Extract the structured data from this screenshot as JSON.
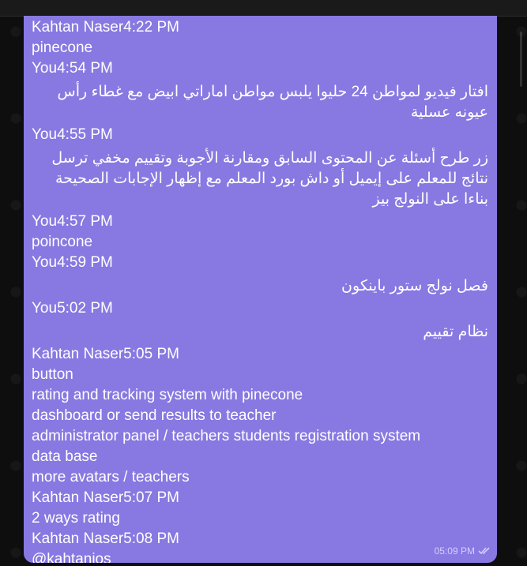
{
  "messages": [
    {
      "type": "header",
      "text": "Kahtan Naser4:22 PM"
    },
    {
      "type": "ltr",
      "text": "pinecone"
    },
    {
      "type": "header",
      "text": "You4:54 PM"
    },
    {
      "type": "rtl",
      "text": "افتار فيديو لمواطن 24  حليوا  يلبس مواطن اماراتي ابيض  مع غطاء رأس   عيونه عسلية"
    },
    {
      "type": "header",
      "text": "You4:55 PM"
    },
    {
      "type": "rtl",
      "text": "زر  طرح أسئلة  عن المحتوى السابق  ومقارنة الأجوبة وتقييم مخفي ترسل نتائج للمعلم  على إيميل أو داش بورد المعلم   مع إظهار الإجابات الصحيحة بناءا على النولج بيز"
    },
    {
      "type": "header",
      "text": "You4:57 PM"
    },
    {
      "type": "ltr",
      "text": "poincone"
    },
    {
      "type": "header",
      "text": "You4:59 PM"
    },
    {
      "type": "rtl",
      "text": "فصل  نولج ستور  باينكون"
    },
    {
      "type": "header",
      "text": "You5:02 PM"
    },
    {
      "type": "rtl",
      "text": "نظام تقييم"
    },
    {
      "type": "header",
      "text": "Kahtan Naser5:05 PM"
    },
    {
      "type": "ltr",
      "text": "button"
    },
    {
      "type": "ltr",
      "text": "rating and tracking system with pinecone"
    },
    {
      "type": "ltr",
      "text": "dashboard or send results to teacher"
    },
    {
      "type": "ltr",
      "text": "administrator panel / teachers students registration system"
    },
    {
      "type": "ltr",
      "text": "data base"
    },
    {
      "type": "ltr",
      "text": "more avatars / teachers"
    },
    {
      "type": "header",
      "text": "Kahtan Naser5:07 PM"
    },
    {
      "type": "ltr",
      "text": "2 ways rating"
    },
    {
      "type": "header",
      "text": "Kahtan Naser5:08 PM"
    },
    {
      "type": "ltr",
      "text": "@kahtanios"
    }
  ],
  "footer": {
    "time": "05:09 PM",
    "status_icon": "double-check-icon"
  },
  "colors": {
    "bubble": "#8878e1",
    "background": "#0e0e0e",
    "text": "#ffffff"
  }
}
